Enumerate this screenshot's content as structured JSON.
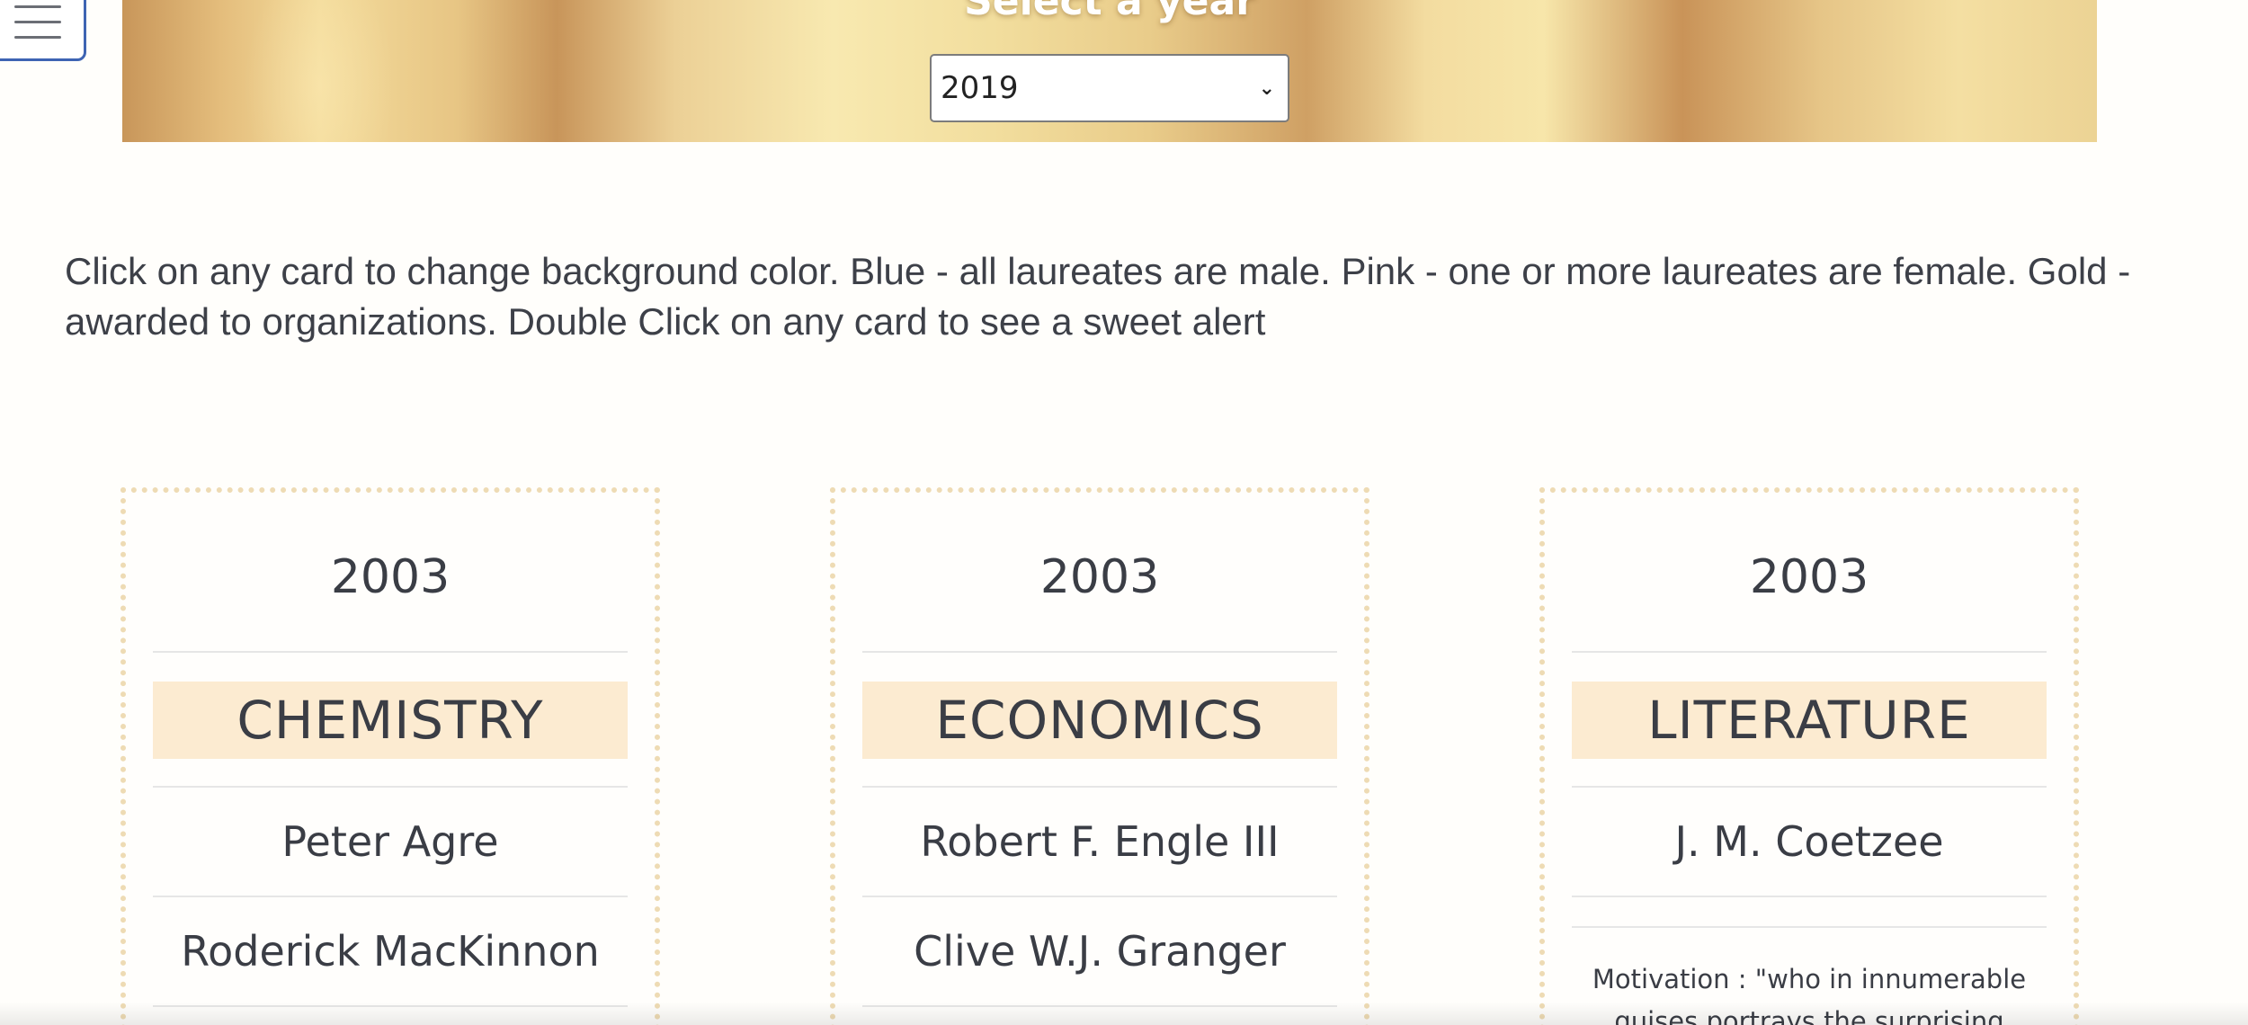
{
  "header": {
    "title": "Select a year",
    "year_select": {
      "value": "2019"
    }
  },
  "instructions": "Click on any card to change background color. Blue - all laureates are male. Pink - one or more laureates are female. Gold - awarded to organizations. Double Click on any card to see a sweet alert",
  "cards": [
    {
      "year": "2003",
      "category": "CHEMISTRY",
      "laureates": [
        "Peter Agre",
        "Roderick MacKinnon"
      ]
    },
    {
      "year": "2003",
      "category": "ECONOMICS",
      "laureates": [
        "Robert F. Engle III",
        "Clive W.J. Granger"
      ]
    },
    {
      "year": "2003",
      "category": "LITERATURE",
      "laureates": [
        "J. M. Coetzee"
      ],
      "motivation": "Motivation : \"who in innumerable guises portrays the surprising"
    }
  ],
  "icons": {
    "menu": "hamburger-icon",
    "select_arrow": "chevron-down-icon"
  },
  "colors": {
    "card_border": "#eedbb4",
    "category_bg": "#fcebd1",
    "menu_border": "#3e64b3"
  }
}
